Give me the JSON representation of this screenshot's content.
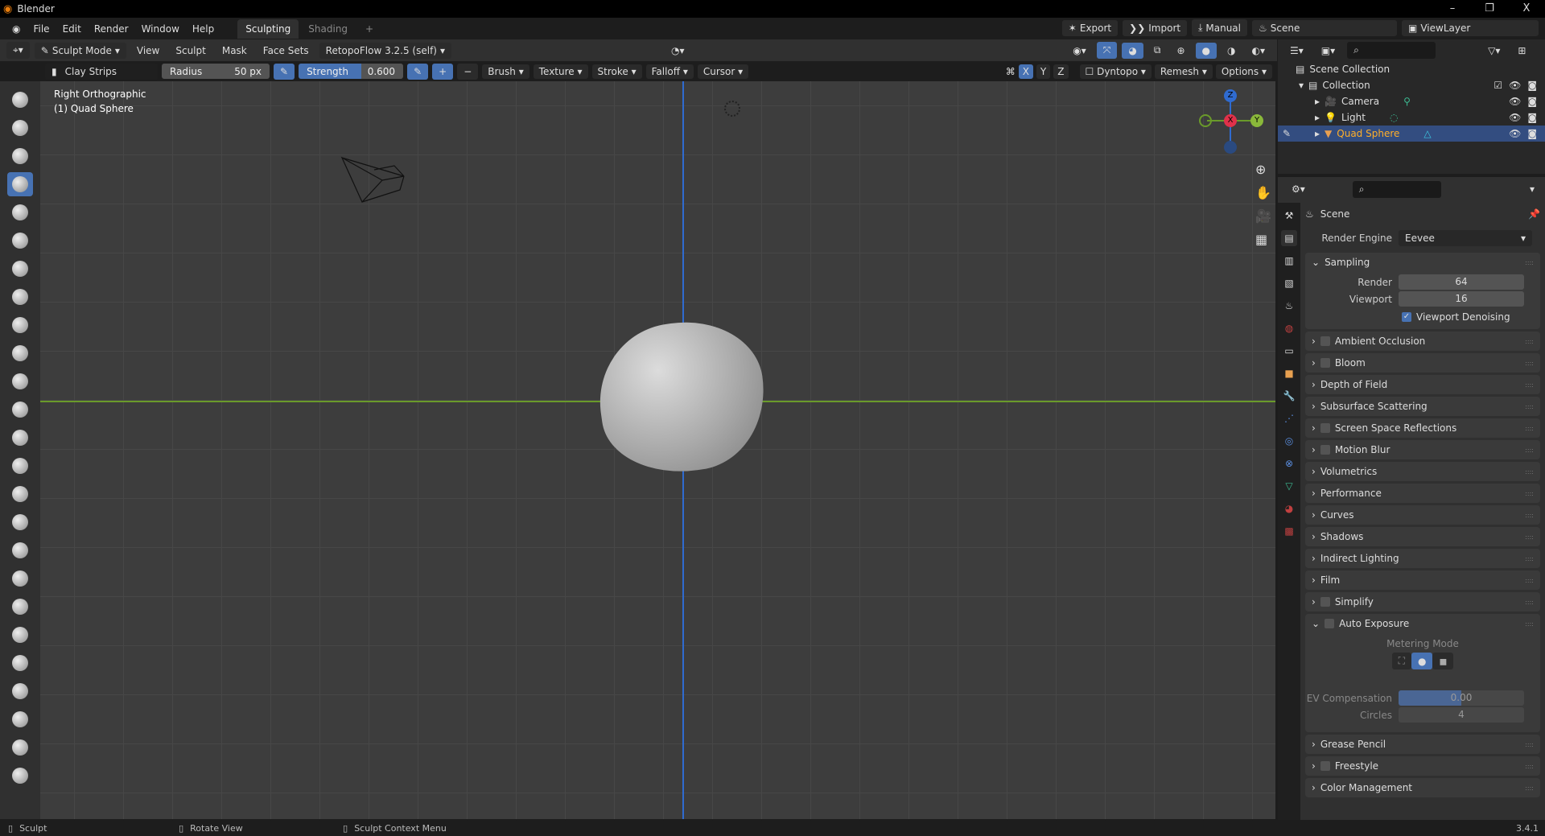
{
  "window": {
    "title": "Blender",
    "minimize": "–",
    "maximize": "❐",
    "close": "X"
  },
  "menu": {
    "items": [
      "File",
      "Edit",
      "Render",
      "Window",
      "Help"
    ],
    "workspaces": [
      "Sculpting",
      "Shading"
    ],
    "add_tab": "+"
  },
  "topbar": {
    "export": "Export",
    "import": "Import",
    "manual": "Manual",
    "scene": "Scene",
    "view_layer": "ViewLayer"
  },
  "header": {
    "mode": "Sculpt Mode",
    "menus": [
      "View",
      "Sculpt",
      "Mask",
      "Face Sets"
    ],
    "addon": "RetopoFlow 3.2.5 (self)"
  },
  "tool_settings": {
    "brush": "Clay Strips",
    "radius_label": "Radius",
    "radius_value": "50 px",
    "strength_label": "Strength",
    "strength_value": "0.600",
    "strength_fraction": 0.6,
    "plus": "+",
    "minus": "−",
    "menus": [
      "Brush",
      "Texture",
      "Stroke",
      "Falloff",
      "Cursor"
    ],
    "axes": [
      "X",
      "Y",
      "Z"
    ],
    "dyntopo": "Dyntopo",
    "remesh": "Remesh",
    "options": "Options"
  },
  "viewport": {
    "view_name": "Right Orthographic",
    "object_name": "(1) Quad Sphere",
    "gizmo": {
      "z": "Z",
      "y": "Y",
      "x": "X"
    },
    "colors": {
      "y_axis": "#6a9a2a",
      "z_axis": "#2f6bd0"
    }
  },
  "outliner": {
    "root": "Scene Collection",
    "collection": "Collection",
    "objects": [
      {
        "name": "Camera",
        "selected": false
      },
      {
        "name": "Light",
        "selected": false
      },
      {
        "name": "Quad Sphere",
        "selected": true
      }
    ]
  },
  "properties": {
    "context": "Scene",
    "render_engine_label": "Render Engine",
    "render_engine": "Eevee",
    "sampling": {
      "title": "Sampling",
      "render_label": "Render",
      "render": "64",
      "viewport_label": "Viewport",
      "viewport": "16",
      "denoise": "Viewport Denoising",
      "denoise_checked": true
    },
    "panels_a": [
      "Ambient Occlusion",
      "Bloom",
      "Depth of Field",
      "Subsurface Scattering",
      "Screen Space Reflections",
      "Motion Blur",
      "Volumetrics",
      "Performance",
      "Curves",
      "Shadows",
      "Indirect Lighting",
      "Film",
      "Simplify"
    ],
    "auto_exposure": {
      "title": "Auto Exposure",
      "metering_label": "Metering Mode",
      "ev_label": "EV Compensation",
      "ev": "0.00",
      "circles_label": "Circles",
      "circles": "4"
    },
    "panels_b": [
      "Grease Pencil",
      "Freestyle",
      "Color Management"
    ]
  },
  "status": {
    "left": "Sculpt",
    "middle": "Rotate View",
    "right": "Sculpt Context Menu",
    "version": "3.4.1"
  }
}
